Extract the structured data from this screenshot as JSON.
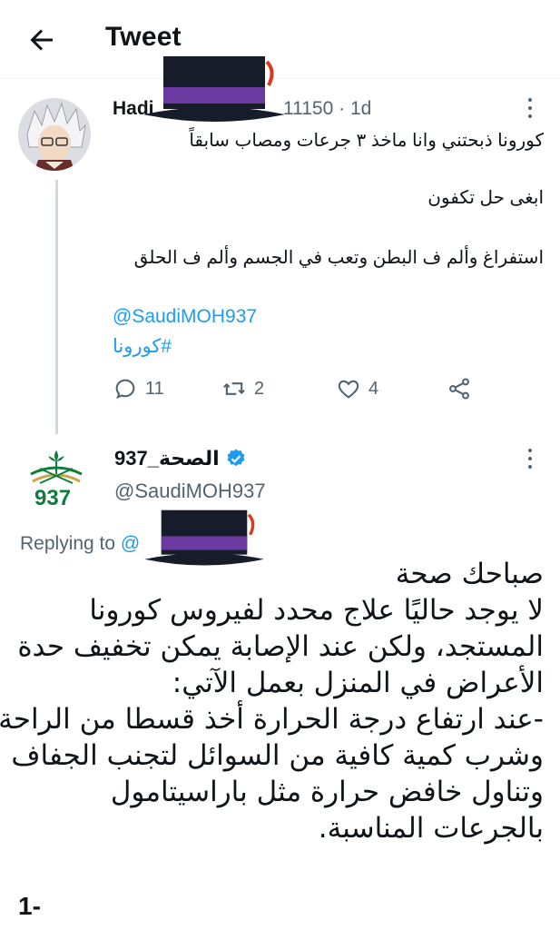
{
  "header": {
    "title": "Tweet"
  },
  "original_tweet": {
    "author_name": "Hadi",
    "handle_suffix": "11150",
    "time": "· 1d",
    "lines": [
      "كورونا ذبحتني وانا ماخذ ٣ جرعات ومصاب سابقاً",
      "ابغى حل تكفون",
      "استفراغ وألم ف البطن وتعب في الجسم وألم ف الحلق"
    ],
    "mention": "@SaudiMOH937",
    "hashtag": "#كورونا",
    "stats": {
      "replies": "11",
      "retweets": "2",
      "likes": "4"
    }
  },
  "reply_tweet": {
    "author_name": "الصحة_937",
    "handle": "@SaudiMOH937",
    "logo_text": "937",
    "replying_label": "Replying to",
    "replying_handle": "@",
    "body_lines": [
      "صباحك صحة",
      "لا يوجد حاليًا علاج محدد لفيروس كورونا",
      "المستجد، ولكن عند الإصابة يمكن تخفيف حدة",
      "الأعراض في المنزل بعمل الآتي:",
      "-عند ارتفاع درجة الحرارة أخذ قسطا من الراحة",
      "وشرب كمية كافية من السوائل لتجنب الجفاف",
      "وتناول خافض حرارة مثل باراسيتامول",
      "بالجرعات المناسبة."
    ],
    "page_label": "1-"
  },
  "colors": {
    "accent": "#1d9bf0",
    "muted": "#536471",
    "logo_green": "#0e7c3a",
    "hat_band": "#6b3aa0"
  }
}
